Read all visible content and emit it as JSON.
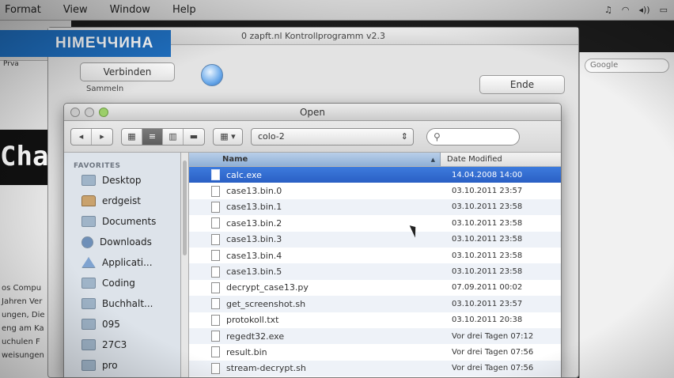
{
  "menubar": {
    "items": [
      "Format",
      "View",
      "Window",
      "Help"
    ]
  },
  "caption": "НІМЕЧЧИНА",
  "background_browser": {
    "nav_text": "Prva",
    "banner_text": "Chaos",
    "lines": [
      "os Compu",
      "Jahren Ver",
      "ungen, Die",
      "eng am Ka",
      "uchulen  F",
      "weisungen"
    ]
  },
  "app_window": {
    "title": "0 zapft.nl Kontrollprogramm v2.3",
    "connect_label": "Verbinden",
    "collect_label": "Sammeln",
    "end_label": "Ende"
  },
  "right_window": {
    "search_placeholder": "Google"
  },
  "dialog": {
    "title": "Open",
    "folder": "colo-2",
    "search_placeholder": "",
    "favorites_heading": "FAVORITES",
    "favorites": [
      {
        "label": "Desktop",
        "icon": "folder-icon"
      },
      {
        "label": "erdgeist",
        "icon": "home-icon"
      },
      {
        "label": "Documents",
        "icon": "folder-icon"
      },
      {
        "label": "Downloads",
        "icon": "downloads-icon"
      },
      {
        "label": "Applicati...",
        "icon": "applications-icon"
      },
      {
        "label": "Coding",
        "icon": "folder-icon"
      },
      {
        "label": "Buchhalt...",
        "icon": "folder-icon"
      },
      {
        "label": "095",
        "icon": "folder-icon"
      },
      {
        "label": "27C3",
        "icon": "folder-icon"
      },
      {
        "label": "pro",
        "icon": "folder-icon"
      }
    ],
    "columns": {
      "name": "Name",
      "date": "Date Modified"
    },
    "files": [
      {
        "name": "calc.exe",
        "date": "14.04.2008 14:00",
        "selected": true
      },
      {
        "name": "case13.bin.0",
        "date": "03.10.2011 23:57",
        "selected": false
      },
      {
        "name": "case13.bin.1",
        "date": "03.10.2011 23:58",
        "selected": false
      },
      {
        "name": "case13.bin.2",
        "date": "03.10.2011 23:58",
        "selected": false
      },
      {
        "name": "case13.bin.3",
        "date": "03.10.2011 23:58",
        "selected": false
      },
      {
        "name": "case13.bin.4",
        "date": "03.10.2011 23:58",
        "selected": false
      },
      {
        "name": "case13.bin.5",
        "date": "03.10.2011 23:58",
        "selected": false
      },
      {
        "name": "decrypt_case13.py",
        "date": "07.09.2011 00:02",
        "selected": false
      },
      {
        "name": "get_screenshot.sh",
        "date": "03.10.2011 23:57",
        "selected": false
      },
      {
        "name": "protokoll.txt",
        "date": "03.10.2011 20:38",
        "selected": false
      },
      {
        "name": "regedt32.exe",
        "date": "Vor drei Tagen 07:12",
        "selected": false
      },
      {
        "name": "result.bin",
        "date": "Vor drei Tagen 07:56",
        "selected": false
      },
      {
        "name": "stream-decrypt.sh",
        "date": "Vor drei Tagen 07:56",
        "selected": false
      }
    ]
  }
}
